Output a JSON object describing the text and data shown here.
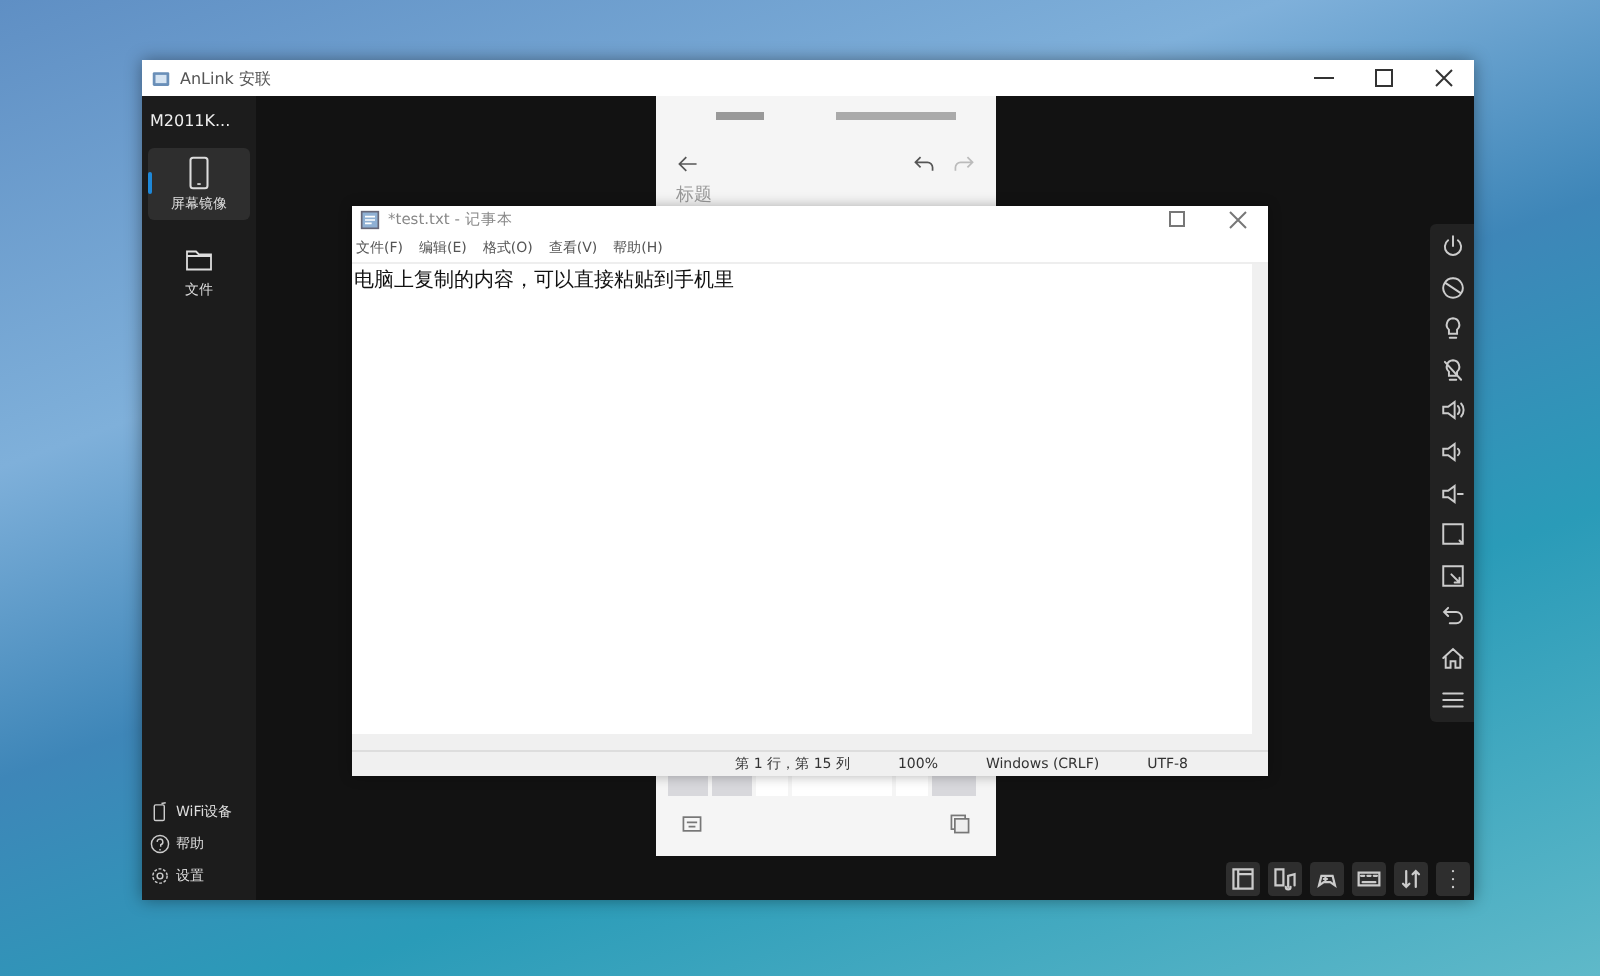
{
  "app_window": {
    "title": "AnLink 安联",
    "device_name": "M2011K...",
    "nav_items": [
      {
        "kind": "mirror",
        "label": "屏幕镜像",
        "selected": true
      },
      {
        "kind": "files",
        "label": "文件",
        "selected": false
      }
    ],
    "bottom_items": [
      {
        "kind": "wifi",
        "label": "WiFi设备"
      },
      {
        "kind": "help",
        "label": "帮助"
      },
      {
        "kind": "settings",
        "label": "设置"
      }
    ]
  },
  "phone_screen": {
    "title": "标题"
  },
  "notepad": {
    "title": "*test.txt - 记事本",
    "menu": [
      "文件(F)",
      "编辑(E)",
      "格式(O)",
      "查看(V)",
      "帮助(H)"
    ],
    "content": "电脑上复制的内容，可以直接粘贴到手机里",
    "status": [
      "第 1 行，第 15 列",
      "100%",
      "Windows (CRLF)",
      "UTF-8"
    ]
  }
}
